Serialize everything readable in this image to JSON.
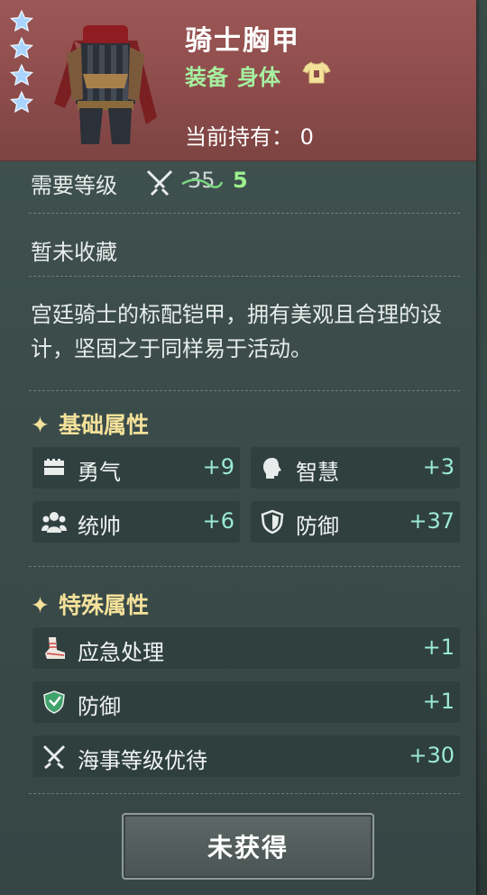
{
  "item": {
    "name": "骑士胸甲",
    "category": "装备",
    "slot": "身体",
    "held_label": "当前持有：",
    "held_count": "0",
    "stars": 4
  },
  "level": {
    "label": "需要等级",
    "old": "35",
    "new": "5"
  },
  "collection_status": "暂未收藏",
  "description": "宫廷骑士的标配铠甲，拥有美观且合理的设计，坚固之于同样易于活动。",
  "base_attrs": {
    "title": "基础属性",
    "spark": "✦",
    "items": [
      {
        "label": "勇气",
        "value": "+9",
        "icon": "courage-icon"
      },
      {
        "label": "智慧",
        "value": "+3",
        "icon": "wisdom-icon"
      },
      {
        "label": "统帅",
        "value": "+6",
        "icon": "command-icon"
      },
      {
        "label": "防御",
        "value": "+37",
        "icon": "shield-icon"
      }
    ]
  },
  "special_attrs": {
    "title": "特殊属性",
    "spark": "✦",
    "items": [
      {
        "label": "应急处理",
        "value": "+1",
        "icon": "bandage-icon"
      },
      {
        "label": "防御",
        "value": "+1",
        "icon": "defense-shield-icon"
      },
      {
        "label": "海事等级优待",
        "value": "+30",
        "icon": "crossed-swords-icon"
      }
    ]
  },
  "button": {
    "label": "未获得"
  },
  "colors": {
    "header": "#8d4c4b",
    "green": "#9cf08e",
    "value": "#9be9d6",
    "section": "#f4e19a"
  }
}
